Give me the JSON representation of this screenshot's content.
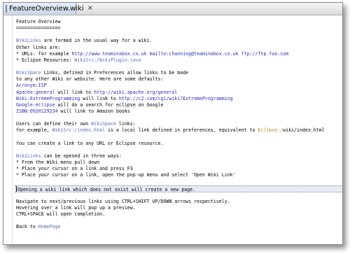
{
  "tab": {
    "title": "FeatureOverview.wiki"
  },
  "lines": [
    [
      {
        "t": "Feature Overview",
        "c": ""
      }
    ],
    [
      {
        "t": "================",
        "c": ""
      }
    ],
    [],
    [
      {
        "t": "WikiLinks",
        "c": "wl"
      },
      {
        "t": " are formed in the usual way for a wiki.",
        "c": ""
      }
    ],
    [
      {
        "t": "Other links are:",
        "c": ""
      }
    ],
    [
      {
        "t": "* URLs: for example ",
        "c": ""
      },
      {
        "t": "http://www.teaminabox.co.uk",
        "c": "bl"
      },
      {
        "t": " ",
        "c": ""
      },
      {
        "t": "mailto:channing@teaminabox.co.uk",
        "c": "bl"
      },
      {
        "t": " ",
        "c": ""
      },
      {
        "t": "ftp://ftp.foo.com",
        "c": "bl"
      }
    ],
    [
      {
        "t": "* Eclipse Resources: ",
        "c": ""
      },
      {
        "t": "WikiSrc:/WikiPlugin.java",
        "c": "wl"
      }
    ],
    [],
    [
      {
        "t": "WikiSpace",
        "c": "wl"
      },
      {
        "t": " Links, defined in Preferences allow links to be made",
        "c": ""
      }
    ],
    [
      {
        "t": "to any other Wiki or website. Here are some defaults:",
        "c": ""
      }
    ],
    [
      {
        "t": "Acronym:ISP",
        "c": "bl"
      }
    ],
    [
      {
        "t": "Apache:general",
        "c": "bl"
      },
      {
        "t": " will link to ",
        "c": ""
      },
      {
        "t": "http://wiki.apache.org/general",
        "c": "bl"
      }
    ],
    [
      {
        "t": "Wiki:ExtremeProgramming",
        "c": "bl"
      },
      {
        "t": " will link to ",
        "c": ""
      },
      {
        "t": "http://c2.com/cgi/wiki?ExtremeProgramming",
        "c": "bl"
      }
    ],
    [
      {
        "t": "Google:eclipse",
        "c": "bl"
      },
      {
        "t": " will do a search for eclipse on Google",
        "c": ""
      }
    ],
    [
      {
        "t": "ISBN:0920129234",
        "c": "bl"
      },
      {
        "t": " will link to Amazon books",
        "c": ""
      }
    ],
    [],
    [
      {
        "t": "Users can define their own ",
        "c": ""
      },
      {
        "t": "WikiSpace",
        "c": "wl"
      },
      {
        "t": " links:",
        "c": ""
      }
    ],
    [
      {
        "t": "for example, ",
        "c": ""
      },
      {
        "t": "WikiSrc:/index.html",
        "c": "wl"
      },
      {
        "t": " is a local link defined in preferences, equivalent to ",
        "c": ""
      },
      {
        "t": "Eclipse:/",
        "c": "or"
      },
      {
        "t": "wiki/index.html",
        "c": ""
      }
    ],
    [],
    [
      {
        "t": "You can create a link to any URL or Eclipse resource.",
        "c": ""
      }
    ],
    [],
    [
      {
        "t": "WikiLinks",
        "c": "wl"
      },
      {
        "t": " can be opened in three ways:",
        "c": ""
      }
    ],
    [
      {
        "t": "* From the Wiki menu pull down",
        "c": ""
      }
    ],
    [
      {
        "t": "* Place your cursor on a link and press F3",
        "c": ""
      }
    ],
    [
      {
        "t": "* Place your cursor on a link, open the pop-up menu and select 'Open Wiki Link'",
        "c": ""
      }
    ],
    [],
    [
      {
        "t": "Opening a wiki link which does not exist will create a new page.",
        "c": ""
      }
    ],
    [],
    [
      {
        "t": "Navigate to next/previous links using CTRL+SHIFT UP/DOWN arrows respectively.",
        "c": ""
      }
    ],
    [
      {
        "t": "Hovering over a link will pop up a preview.",
        "c": ""
      }
    ],
    [
      {
        "t": "CTRL+SPACE will open completion.",
        "c": ""
      }
    ],
    [],
    [
      {
        "t": "Back to ",
        "c": ""
      },
      {
        "t": "HomePage",
        "c": "wl"
      }
    ]
  ],
  "current_line_index": 26
}
